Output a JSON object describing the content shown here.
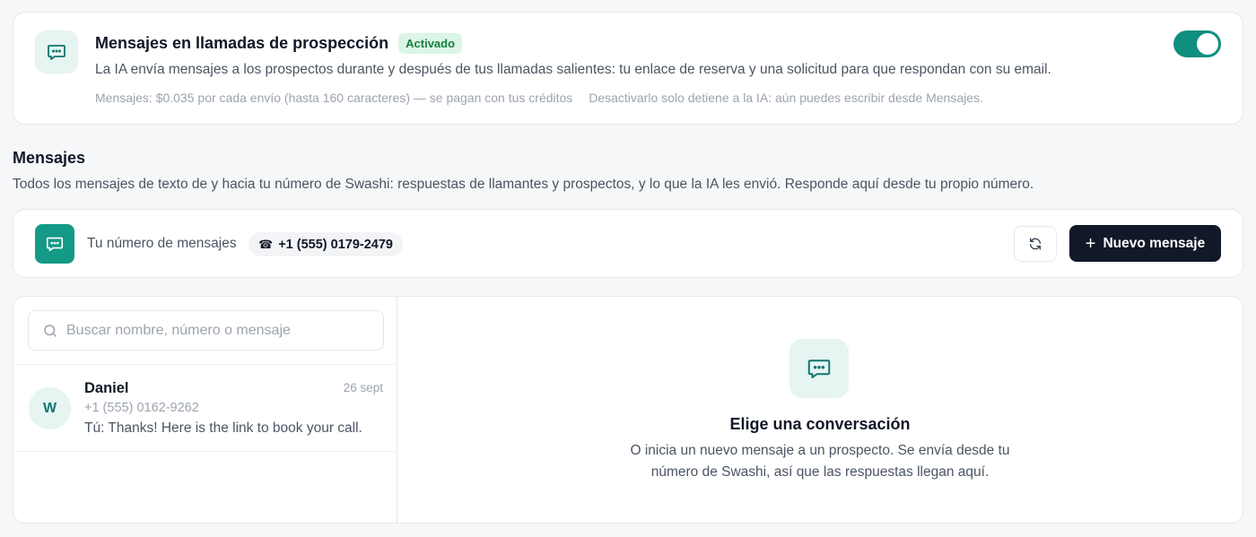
{
  "ai_feature": {
    "title": "Mensajes en llamadas de prospección",
    "badge": "Activado",
    "description": "La IA envía mensajes a los prospectos durante y después de tus llamadas salientes: tu enlace de reserva y una solicitud para que respondan con su email.",
    "pricing_note": "Mensajes: $0.035 por cada envío (hasta 160 caracteres) — se pagan con tus créditos",
    "disable_note": "Desactivarlo solo detiene a la IA: aún puedes escribir desde Mensajes.",
    "toggle_on": true,
    "icon": "message-bubble-icon"
  },
  "messages_section": {
    "title": "Mensajes",
    "description": "Todos los mensajes de texto de y hacia tu número de Swashi: respuestas de llamantes y prospectos, y lo que la IA les envió. Responde aquí desde tu propio número."
  },
  "number_bar": {
    "label": "Tu número de mensajes",
    "phone_glyph": "☎",
    "phone_number": "+1 (555) 0179-2479",
    "refresh_icon": "refresh-icon",
    "new_message_plus": "+",
    "new_message_label": "Nuevo mensaje"
  },
  "search": {
    "placeholder": "Buscar nombre, número o mensaje",
    "value": ""
  },
  "conversations": [
    {
      "avatar_initial": "W",
      "name": "Daniel",
      "date": "26 sept",
      "phone": "+1 (555) 0162-9262",
      "preview": "Tú: Thanks! Here is the link to book your call."
    }
  ],
  "empty_state": {
    "title": "Elige una conversación",
    "description_line1": "O inicia un nuevo mensaje a un prospecto. Se envía desde tu",
    "description_line2": "número de Swashi, así que las respuestas llegan aquí."
  },
  "colors": {
    "accent": "#0f8f7e",
    "accent_light": "#e6f4f2",
    "badge_bg": "#dcf5e7",
    "badge_text": "#15803d",
    "primary_button": "#111827"
  }
}
